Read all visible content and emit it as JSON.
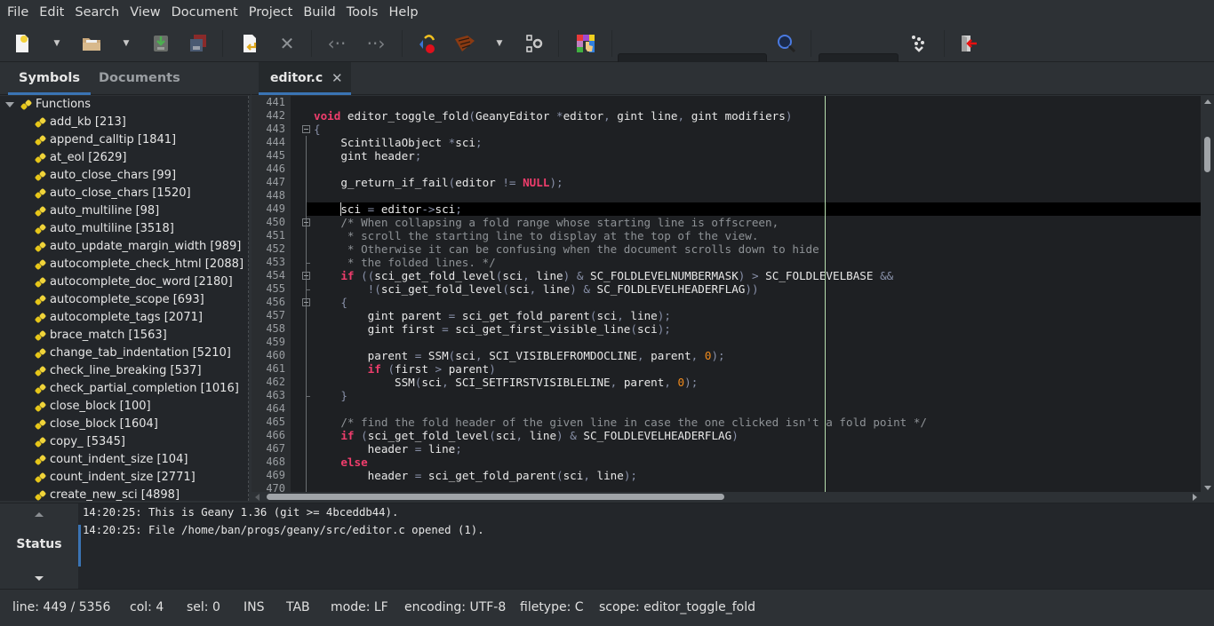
{
  "menu": [
    "File",
    "Edit",
    "Search",
    "View",
    "Document",
    "Project",
    "Build",
    "Tools",
    "Help"
  ],
  "toolbar": {
    "buttons": [
      {
        "name": "new-file",
        "icon": "new-file-icon"
      },
      {
        "name": "open-file",
        "icon": "open-folder-icon"
      },
      {
        "name": "save",
        "icon": "save-icon"
      },
      {
        "name": "save-all",
        "icon": "save-all-icon"
      },
      {
        "name": "reload",
        "icon": "reload-icon"
      },
      {
        "name": "close",
        "icon": "close-icon"
      },
      {
        "name": "back",
        "icon": "navigate-back-icon"
      },
      {
        "name": "forward",
        "icon": "navigate-forward-icon"
      },
      {
        "name": "compile",
        "icon": "compile-icon"
      },
      {
        "name": "build",
        "icon": "build-brick-icon"
      },
      {
        "name": "execute",
        "icon": "execute-gears-icon"
      },
      {
        "name": "color-chooser",
        "icon": "color-chooser-icon"
      },
      {
        "name": "search",
        "icon": "magnifier-icon"
      },
      {
        "name": "goto-line",
        "icon": "jump-to-line-icon"
      },
      {
        "name": "quit",
        "icon": "quit-door-icon"
      }
    ],
    "search_value": "",
    "goto_value": ""
  },
  "sidebar": {
    "tabs": [
      "Symbols",
      "Documents"
    ],
    "active_tab": "Symbols",
    "group_label": "Functions",
    "symbols": [
      "add_kb [213]",
      "append_calltip [1841]",
      "at_eol [2629]",
      "auto_close_chars [99]",
      "auto_close_chars [1520]",
      "auto_multiline [98]",
      "auto_multiline [3518]",
      "auto_update_margin_width [989]",
      "autocomplete_check_html [2088]",
      "autocomplete_doc_word [2180]",
      "autocomplete_scope [693]",
      "autocomplete_tags [2071]",
      "brace_match [1563]",
      "change_tab_indentation [5210]",
      "check_line_breaking [537]",
      "check_partial_completion [1016]",
      "close_block [100]",
      "close_block [1604]",
      "copy_ [5345]",
      "count_indent_size [104]",
      "count_indent_size [2771]",
      "create_new_sci [4898]"
    ]
  },
  "editor": {
    "tab_label": "editor.c",
    "tab_close": "✕",
    "current_line": 449,
    "lines": [
      {
        "n": "441",
        "html": ""
      },
      {
        "n": "442",
        "html": "<span class=\"kw\">void</span> editor_toggle_fold<span class=\"op\">(</span>GeanyEditor <span class=\"op\">*</span>editor<span class=\"op\">,</span> gint line<span class=\"op\">,</span> gint modifiers<span class=\"op\">)</span>"
      },
      {
        "n": "443",
        "html": "<span class=\"op\">{</span>"
      },
      {
        "n": "444",
        "html": "    ScintillaObject <span class=\"op\">*</span>sci<span class=\"op\">;</span>"
      },
      {
        "n": "445",
        "html": "    gint header<span class=\"op\">;</span>"
      },
      {
        "n": "446",
        "html": ""
      },
      {
        "n": "447",
        "html": "    g_return_if_fail<span class=\"op\">(</span>editor <span class=\"op\">!=</span> <span class=\"kw\">NULL</span><span class=\"op\">);</span>"
      },
      {
        "n": "448",
        "html": ""
      },
      {
        "n": "449",
        "html": "    sci <span class=\"op\">=</span> editor<span class=\"op\">-&gt;</span>sci<span class=\"op\">;</span>"
      },
      {
        "n": "450",
        "html": "    <span class=\"cm\">/* When collapsing a fold range whose starting line is offscreen,</span>"
      },
      {
        "n": "451",
        "html": "<span class=\"cm\">     * scroll the starting line to display at the top of the view.</span>"
      },
      {
        "n": "452",
        "html": "<span class=\"cm\">     * Otherwise it can be confusing when the document scrolls down to hide</span>"
      },
      {
        "n": "453",
        "html": "<span class=\"cm\">     * the folded lines. */</span>"
      },
      {
        "n": "454",
        "html": "    <span class=\"kw\">if</span> <span class=\"op\">((</span>sci_get_fold_level<span class=\"op\">(</span>sci<span class=\"op\">,</span> line<span class=\"op\">)</span> <span class=\"op\">&amp;</span> SC_FOLDLEVELNUMBERMASK<span class=\"op\">)</span> <span class=\"op\">&gt;</span> SC_FOLDLEVELBASE <span class=\"op\">&amp;&amp;</span>"
      },
      {
        "n": "455",
        "html": "        <span class=\"op\">!(</span>sci_get_fold_level<span class=\"op\">(</span>sci<span class=\"op\">,</span> line<span class=\"op\">)</span> <span class=\"op\">&amp;</span> SC_FOLDLEVELHEADERFLAG<span class=\"op\">))</span>"
      },
      {
        "n": "456",
        "html": "    <span class=\"op\">{</span>"
      },
      {
        "n": "457",
        "html": "        gint parent <span class=\"op\">=</span> sci_get_fold_parent<span class=\"op\">(</span>sci<span class=\"op\">,</span> line<span class=\"op\">);</span>"
      },
      {
        "n": "458",
        "html": "        gint first <span class=\"op\">=</span> sci_get_first_visible_line<span class=\"op\">(</span>sci<span class=\"op\">);</span>"
      },
      {
        "n": "459",
        "html": ""
      },
      {
        "n": "460",
        "html": "        parent <span class=\"op\">=</span> SSM<span class=\"op\">(</span>sci<span class=\"op\">,</span> SCI_VISIBLEFROMDOCLINE<span class=\"op\">,</span> parent<span class=\"op\">,</span> <span class=\"num\">0</span><span class=\"op\">);</span>"
      },
      {
        "n": "461",
        "html": "        <span class=\"kw\">if</span> <span class=\"op\">(</span>first <span class=\"op\">&gt;</span> parent<span class=\"op\">)</span>"
      },
      {
        "n": "462",
        "html": "            SSM<span class=\"op\">(</span>sci<span class=\"op\">,</span> SCI_SETFIRSTVISIBLELINE<span class=\"op\">,</span> parent<span class=\"op\">,</span> <span class=\"num\">0</span><span class=\"op\">);</span>"
      },
      {
        "n": "463",
        "html": "    <span class=\"op\">}</span>"
      },
      {
        "n": "464",
        "html": ""
      },
      {
        "n": "465",
        "html": "    <span class=\"cm\">/* find the fold header of the given line in case the one clicked isn't a fold point */</span>"
      },
      {
        "n": "466",
        "html": "    <span class=\"kw\">if</span> <span class=\"op\">(</span>sci_get_fold_level<span class=\"op\">(</span>sci<span class=\"op\">,</span> line<span class=\"op\">)</span> <span class=\"op\">&amp;</span> SC_FOLDLEVELHEADERFLAG<span class=\"op\">)</span>"
      },
      {
        "n": "467",
        "html": "        header <span class=\"op\">=</span> line<span class=\"op\">;</span>"
      },
      {
        "n": "468",
        "html": "    <span class=\"kw\">else</span>"
      },
      {
        "n": "469",
        "html": "        header <span class=\"op\">=</span> sci_get_fold_parent<span class=\"op\">(</span>sci<span class=\"op\">,</span> line<span class=\"op\">);</span>"
      },
      {
        "n": "470",
        "html": ""
      }
    ]
  },
  "messages": {
    "tab_label": "Status",
    "lines": [
      "14:20:25: This is Geany 1.36 (git >= 4bceddb44).",
      "14:20:25: File /home/ban/progs/geany/src/editor.c opened (1)."
    ]
  },
  "statusbar": {
    "line": "line: 449 / 5356",
    "col": "col: 4",
    "sel": "sel: 0",
    "ins": "INS",
    "tab": "TAB",
    "mode": "mode: LF",
    "encoding": "encoding: UTF-8",
    "filetype": "filetype: C",
    "scope": "scope: editor_toggle_fold"
  },
  "colors": {
    "accent": "#3a74b4",
    "keyword": "#ef3d6c",
    "number": "#f08a1c",
    "comment": "#8e9296",
    "long_line_marker": "#b8e0b0"
  }
}
